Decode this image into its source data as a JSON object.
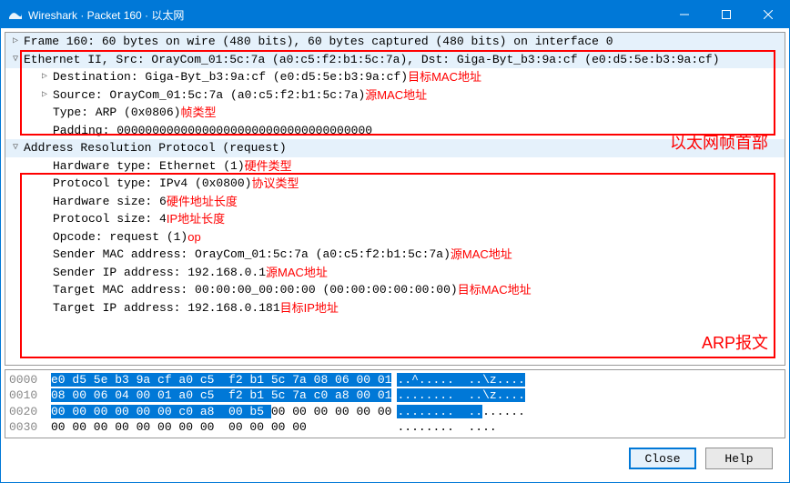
{
  "title": "Wireshark · Packet 160 · 以太网",
  "tree": {
    "frame": "Frame 160: 60 bytes on wire (480 bits), 60 bytes captured (480 bits) on interface 0",
    "eth_header": "Ethernet II, Src: OrayCom_01:5c:7a (a0:c5:f2:b1:5c:7a), Dst: Giga-Byt_b3:9a:cf (e0:d5:5e:b3:9a:cf)",
    "eth_dst": "Destination: Giga-Byt_b3:9a:cf (e0:d5:5e:b3:9a:cf)",
    "eth_dst_annot": "目标MAC地址",
    "eth_src": "Source: OrayCom_01:5c:7a (a0:c5:f2:b1:5c:7a)",
    "eth_src_annot": "源MAC地址",
    "eth_type": "Type: ARP (0x0806)",
    "eth_type_annot": "帧类型",
    "eth_pad": "Padding: 000000000000000000000000000000000000",
    "eth_big_annot": "以太网帧首部",
    "arp_header": "Address Resolution Protocol (request)",
    "arp_hw_type": "Hardware type: Ethernet (1)",
    "arp_hw_type_annot": "硬件类型",
    "arp_proto_type": "Protocol type: IPv4 (0x0800)",
    "arp_proto_type_annot": "协议类型",
    "arp_hw_size": "Hardware size: 6",
    "arp_hw_size_annot": "硬件地址长度",
    "arp_proto_size": "Protocol size: 4",
    "arp_proto_size_annot": "IP地址长度",
    "arp_opcode": "Opcode: request (1)",
    "arp_opcode_annot": "op",
    "arp_sender_mac": "Sender MAC address: OrayCom_01:5c:7a (a0:c5:f2:b1:5c:7a)",
    "arp_sender_mac_annot": "源MAC地址",
    "arp_sender_ip": "Sender IP address: 192.168.0.1",
    "arp_sender_ip_annot": "源MAC地址",
    "arp_target_mac": "Target MAC address: 00:00:00_00:00:00 (00:00:00:00:00:00)",
    "arp_target_mac_annot": "目标MAC地址",
    "arp_target_ip": "Target IP address: 192.168.0.181",
    "arp_target_ip_annot": "目标IP地址",
    "arp_big_annot": "ARP报文"
  },
  "hex": {
    "rows": [
      {
        "offset": "0000",
        "b1": "e0 d5 5e b3 9a cf a0 c5 ",
        "b2": " f2 b1 5c 7a 08 06 ",
        "b3": "00 01",
        "a1": "..^.....  ..\\z....",
        "a2": ""
      },
      {
        "offset": "0010",
        "b1": "",
        "b2": "08 00 06 04 00 01 a0 c5  f2 b1 5c 7a c0 a8 00 01",
        "b3": "",
        "a1": "",
        "a2": "........  ..\\z...."
      },
      {
        "offset": "0020",
        "b1": "",
        "b2": "00 00 00 00 00 00 c0 a8  00 b5 ",
        "b3": "00 00 00 00 00 00",
        "a2": "........  ..",
        "a1": "......"
      },
      {
        "offset": "0030",
        "b1": "",
        "b2": "",
        "b3": "00 00 00 00 00 00 00 00  00 00 00 00",
        "a1": "........  ....",
        "a2": ""
      }
    ]
  },
  "buttons": {
    "close": "Close",
    "help": "Help"
  }
}
